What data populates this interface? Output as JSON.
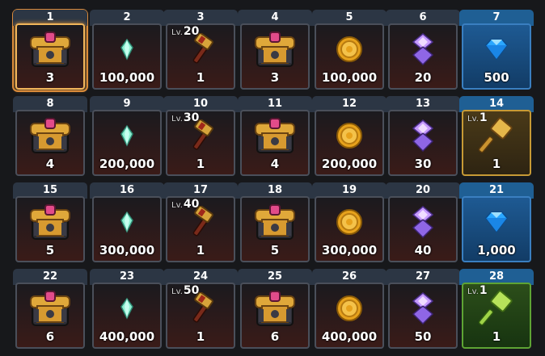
{
  "rewards": [
    {
      "day": "1",
      "amount": "3",
      "icon": "chest",
      "tier": "normal",
      "selected": true
    },
    {
      "day": "2",
      "amount": "100,000",
      "icon": "crystal",
      "tier": "normal"
    },
    {
      "day": "3",
      "amount": "1",
      "icon": "hammer",
      "tier": "normal",
      "lv_prefix": "Lv.",
      "lv": "20"
    },
    {
      "day": "4",
      "amount": "3",
      "icon": "chest",
      "tier": "normal"
    },
    {
      "day": "5",
      "amount": "100,000",
      "icon": "coin",
      "tier": "normal"
    },
    {
      "day": "6",
      "amount": "20",
      "icon": "purple-gem",
      "tier": "normal"
    },
    {
      "day": "7",
      "amount": "500",
      "icon": "diamond",
      "tier": "blue"
    },
    {
      "day": "8",
      "amount": "4",
      "icon": "chest",
      "tier": "normal"
    },
    {
      "day": "9",
      "amount": "200,000",
      "icon": "crystal",
      "tier": "normal"
    },
    {
      "day": "10",
      "amount": "1",
      "icon": "hammer",
      "tier": "normal",
      "lv_prefix": "Lv.",
      "lv": "30"
    },
    {
      "day": "11",
      "amount": "4",
      "icon": "chest",
      "tier": "normal"
    },
    {
      "day": "12",
      "amount": "200,000",
      "icon": "coin",
      "tier": "normal"
    },
    {
      "day": "13",
      "amount": "30",
      "icon": "purple-gem",
      "tier": "normal"
    },
    {
      "day": "14",
      "amount": "1",
      "icon": "gold-hammer",
      "tier": "gold",
      "lv_prefix": "Lv.",
      "lv": "1"
    },
    {
      "day": "15",
      "amount": "5",
      "icon": "chest",
      "tier": "normal"
    },
    {
      "day": "16",
      "amount": "300,000",
      "icon": "crystal",
      "tier": "normal"
    },
    {
      "day": "17",
      "amount": "1",
      "icon": "hammer",
      "tier": "normal",
      "lv_prefix": "Lv.",
      "lv": "40"
    },
    {
      "day": "18",
      "amount": "5",
      "icon": "chest",
      "tier": "normal"
    },
    {
      "day": "19",
      "amount": "300,000",
      "icon": "coin",
      "tier": "normal"
    },
    {
      "day": "20",
      "amount": "40",
      "icon": "purple-gem",
      "tier": "normal"
    },
    {
      "day": "21",
      "amount": "1,000",
      "icon": "diamond",
      "tier": "blue"
    },
    {
      "day": "22",
      "amount": "6",
      "icon": "chest",
      "tier": "normal"
    },
    {
      "day": "23",
      "amount": "400,000",
      "icon": "crystal",
      "tier": "normal"
    },
    {
      "day": "24",
      "amount": "1",
      "icon": "hammer",
      "tier": "normal",
      "lv_prefix": "Lv.",
      "lv": "50"
    },
    {
      "day": "25",
      "amount": "6",
      "icon": "chest",
      "tier": "normal"
    },
    {
      "day": "26",
      "amount": "400,000",
      "icon": "coin",
      "tier": "normal"
    },
    {
      "day": "27",
      "amount": "50",
      "icon": "purple-gem",
      "tier": "normal"
    },
    {
      "day": "28",
      "amount": "1",
      "icon": "green-hammer",
      "tier": "green",
      "lv_prefix": "Lv.",
      "lv": "1"
    }
  ]
}
